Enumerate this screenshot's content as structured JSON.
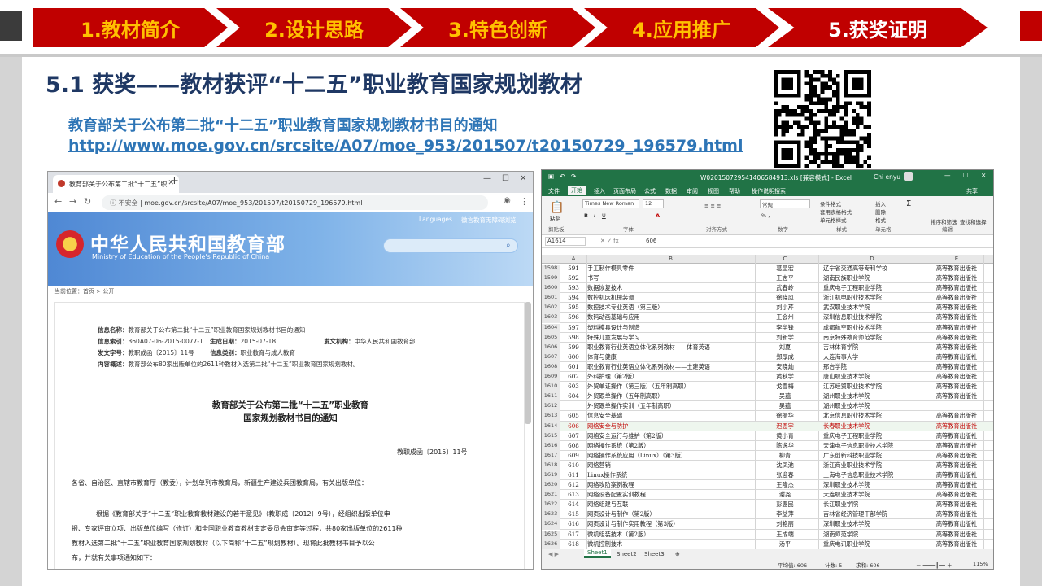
{
  "nav": {
    "items": [
      {
        "label": "1.教材简介",
        "active": false
      },
      {
        "label": "2.设计思路",
        "active": false
      },
      {
        "label": "3.特色创新",
        "active": false
      },
      {
        "label": "4.应用推广",
        "active": false
      },
      {
        "label": "5.获奖证明",
        "active": true
      }
    ]
  },
  "heading": {
    "title": "5.1 获奖——教材获评“十二五”职业教育国家规划教材"
  },
  "notice": {
    "text": "教育部关于公布第二批“十二五”职业教育国家规划教材书目的通知"
  },
  "link": {
    "url": "http://www.moe.gov.cn/srcsite/A07/moe_953/201507/t20150729_196579.html"
  },
  "qr": {
    "icon": "qr-code-icon"
  },
  "browser": {
    "tab_title": "教育部关于公布第二批“十二五”职",
    "not_secure": "不安全",
    "url": "moe.gov.cn/srcsite/A07/moe_953/201507/t20150729_196579.html",
    "top_links": [
      "Languages",
      "微言教育",
      "无障碍浏览"
    ],
    "site_cn": "中华人民共和国教育部",
    "site_en": "Ministry of Education of the People's Republic of China",
    "breadcrumb": "当前位置：首页  >  公开",
    "meta": {
      "name_label": "信息名称：",
      "name_value": "教育部关于公布第二批“十二五”职业教育国家规划教材书目的通知",
      "index_label": "信息索引：",
      "index_value": "360A07-06-2015-0077-1",
      "date_label": "生成日期：",
      "date_value": "2015-07-18",
      "org_label": "发文机构：",
      "org_value": "中华人民共和国教育部",
      "doc_label": "发文字号：",
      "doc_value": "教职成函〔2015〕11号",
      "type_label": "信息类别：",
      "type_value": "职业教育与成人教育",
      "summary_label": "内容概述：",
      "summary_value": "教育部公布80家出版单位的2611种教材入选第二批“十二五”职业教育国家规划教材。"
    },
    "doc_title_1": "教育部关于公布第二批“十二五”职业教育",
    "doc_title_2": "国家规划教材书目的通知",
    "doc_number": "教职成函〔2015〕11号",
    "salutation": "各省、自治区、直辖市教育厅（教委），计划单列市教育局，新疆生产建设兵团教育局，有关出版单位：",
    "para_1": "根据《教育部关于“十二五”职业教育教材建设的若干意见》（教职成〔2012〕9号），经组织出版单位申",
    "para_2": "报、专家评审立项、出版单位编写（修订）和全国职业教育教材审定委员会审定等过程，共80家出版单位的2611种",
    "para_3": "教材入选第二批“十二五”职业教育国家规划教材（以下简称“十二五”规划教材）。现将此批教材书目予以公",
    "para_4": "布，并就有关事项通知如下："
  },
  "excel": {
    "file_title": "W020150729541406584913.xls [兼容模式] - Excel",
    "user": "Chi enyu",
    "tabs": [
      "文件",
      "开始",
      "插入",
      "页面布局",
      "公式",
      "数据",
      "审阅",
      "视图",
      "帮助",
      "操作说明搜索"
    ],
    "share": "共享",
    "font_name": "Times New Roman",
    "font_size": "12",
    "number_format": "常规",
    "groups": [
      "剪贴板",
      "字体",
      "对齐方式",
      "数字",
      "样式",
      "单元格",
      "编辑"
    ],
    "style_items": [
      "条件格式",
      "套用表格格式",
      "单元格样式"
    ],
    "cell_items": [
      "插入",
      "删除",
      "格式"
    ],
    "edit_items": [
      "排序和筛选",
      "查找和选择"
    ],
    "paste": "粘贴",
    "name_box": "A1614",
    "formula": "606",
    "columns": [
      "A",
      "B",
      "C",
      "D",
      "E"
    ],
    "rows": [
      {
        "rn": "1598",
        "v": "591",
        "b": "手工制作模具零件",
        "c": "葛显宏",
        "d": "辽宁省交通高等专科学校",
        "e": "高等教育出版社"
      },
      {
        "rn": "1599",
        "v": "592",
        "b": "书写",
        "c": "王志平",
        "d": "湖南民族职业学院",
        "e": "高等教育出版社"
      },
      {
        "rn": "1600",
        "v": "593",
        "b": "数据恢复技术",
        "c": "武春岭",
        "d": "重庆电子工程职业学院",
        "e": "高等教育出版社"
      },
      {
        "rn": "1601",
        "v": "594",
        "b": "数控机床机械装调",
        "c": "徐晓风",
        "d": "浙江机电职业技术学院",
        "e": "高等教育出版社"
      },
      {
        "rn": "1602",
        "v": "595",
        "b": "数控技术专业英语（第三版）",
        "c": "刘小芹",
        "d": "武汉职业技术学院",
        "e": "高等教育出版社"
      },
      {
        "rn": "1603",
        "v": "596",
        "b": "数码动画基础与应用",
        "c": "王会州",
        "d": "深圳信息职业技术学院",
        "e": "高等教育出版社"
      },
      {
        "rn": "1604",
        "v": "597",
        "b": "塑料模具设计与制造",
        "c": "李学锋",
        "d": "成都航空职业技术学院",
        "e": "高等教育出版社"
      },
      {
        "rn": "1605",
        "v": "598",
        "b": "特殊儿童发展与学习",
        "c": "刘新学",
        "d": "南京特殊教育师范学院",
        "e": "高等教育出版社"
      },
      {
        "rn": "1606",
        "v": "599",
        "b": "职业教育行业英语立体化系列教材——体育英语",
        "c": "刘夏",
        "d": "吉林体育学院",
        "e": "高等教育出版社"
      },
      {
        "rn": "1607",
        "v": "600",
        "b": "体育与健康",
        "c": "郑厚成",
        "d": "大连海事大学",
        "e": "高等教育出版社"
      },
      {
        "rn": "1608",
        "v": "601",
        "b": "职业教育行业英语立体化系列教材——土建英语",
        "c": "安晓灿",
        "d": "邢台学院",
        "e": "高等教育出版社"
      },
      {
        "rn": "1609",
        "v": "602",
        "b": "外科护理（第2版）",
        "c": "黄秋学",
        "d": "唐山职业技术学院",
        "e": "高等教育出版社"
      },
      {
        "rn": "1610",
        "v": "603",
        "b": "外贸单证操作（第三版）（五年制高职）",
        "c": "戈雪梅",
        "d": "江苏经贸职业技术学院",
        "e": "高等教育出版社"
      },
      {
        "rn": "1611",
        "v": "604",
        "b": "外贸跟单操作（五年制高职）",
        "c": "吴蕴",
        "d": "湖州职业技术学院",
        "e": "高等教育出版社"
      },
      {
        "rn": "1612",
        "v": "",
        "b": "外贸跟单操作实训（五年制高职）",
        "c": "吴蕴",
        "d": "湖州职业技术学院",
        "e": ""
      },
      {
        "rn": "1613",
        "v": "605",
        "b": "信息安全基础",
        "c": "徐振华",
        "d": "北京信息职业技术学院",
        "e": "高等教育出版社"
      },
      {
        "rn": "1614",
        "v": "606",
        "b": "网络安全与防护",
        "c": "迟恩宇",
        "d": "长春职业技术学院",
        "e": "高等教育出版社"
      },
      {
        "rn": "1615",
        "v": "607",
        "b": "网络安全运行与维护（第2版）",
        "c": "黄小青",
        "d": "重庆电子工程职业学院",
        "e": "高等教育出版社"
      },
      {
        "rn": "1616",
        "v": "608",
        "b": "网络操作系统（第2版）",
        "c": "陈逸华",
        "d": "天津电子信息职业技术学院",
        "e": "高等教育出版社"
      },
      {
        "rn": "1617",
        "v": "609",
        "b": "网络操作系统应用（Linux）（第3版）",
        "c": "柳青",
        "d": "广东创新科技职业学院",
        "e": "高等教育出版社"
      },
      {
        "rn": "1618",
        "v": "610",
        "b": "网络营销",
        "c": "沈凤池",
        "d": "浙江商业职业技术学院",
        "e": "高等教育出版社"
      },
      {
        "rn": "1619",
        "v": "611",
        "b": "Linux操作系统",
        "c": "张迎春",
        "d": "上海电子信息职业技术学院",
        "e": "高等教育出版社"
      },
      {
        "rn": "1620",
        "v": "612",
        "b": "网络攻防案例教程",
        "c": "王隆杰",
        "d": "深圳职业技术学院",
        "e": "高等教育出版社"
      },
      {
        "rn": "1621",
        "v": "613",
        "b": "网络设备配置实训教程",
        "c": "谢尧",
        "d": "大连职业技术学院",
        "e": "高等教育出版社"
      },
      {
        "rn": "1622",
        "v": "614",
        "b": "网络组建与互联",
        "c": "彭惠民",
        "d": "长江职业学院",
        "e": "高等教育出版社"
      },
      {
        "rn": "1623",
        "v": "615",
        "b": "网页设计与制作（第2版）",
        "c": "李益萍",
        "d": "吉林省经济管理干部学院",
        "e": "高等教育出版社"
      },
      {
        "rn": "1624",
        "v": "616",
        "b": "网页设计与制作实用教程（第3版）",
        "c": "刘艳丽",
        "d": "深圳职业技术学院",
        "e": "高等教育出版社"
      },
      {
        "rn": "1625",
        "v": "617",
        "b": "微机组装技术（第2版）",
        "c": "王成端",
        "d": "湖南师范学院",
        "e": "高等教育出版社"
      },
      {
        "rn": "1626",
        "v": "618",
        "b": "微机控制技术",
        "c": "汤平",
        "d": "重庆电讯职业学院",
        "e": "高等教育出版社"
      }
    ],
    "sheets": [
      "Sheet1",
      "Sheet2",
      "Sheet3"
    ],
    "status_avg": "平均值: 606",
    "status_count": "计数: 5",
    "status_sum": "求和: 606",
    "zoom": "115%"
  }
}
